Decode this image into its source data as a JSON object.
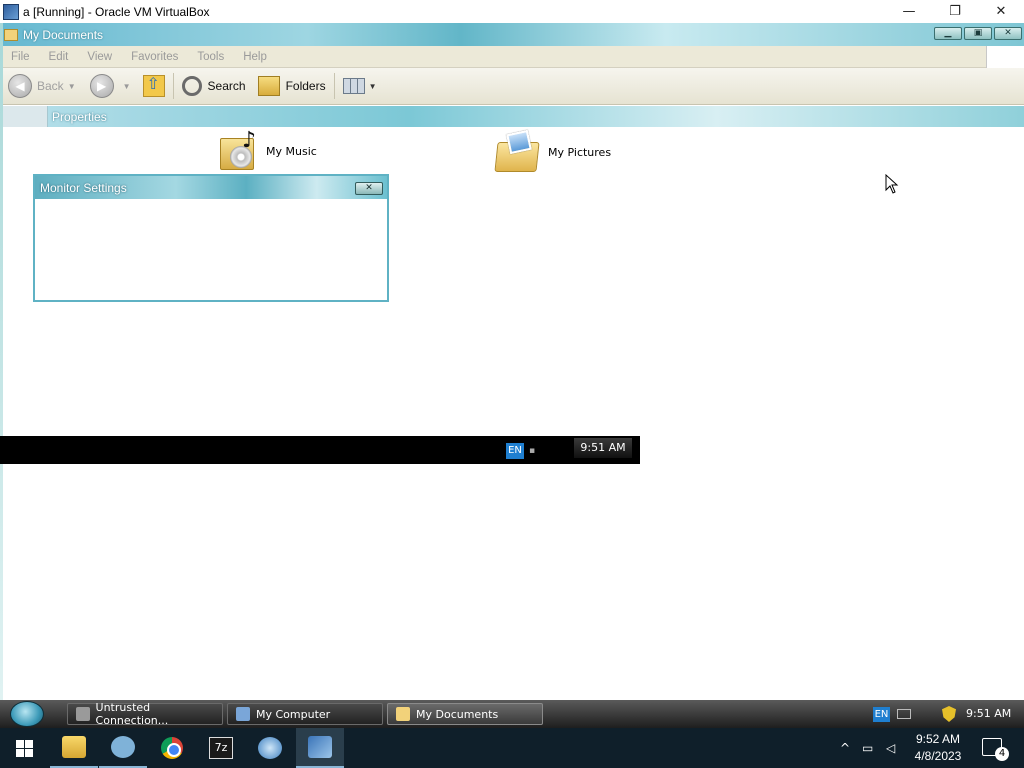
{
  "host_window": {
    "title": "a [Running] - Oracle VM VirtualBox",
    "controls": {
      "minimize": "—",
      "restore": "❐",
      "close": "✕"
    }
  },
  "explorer": {
    "title": "My Documents",
    "controls": {
      "minimize": "▁",
      "maximize": "▣",
      "close": "✕"
    },
    "menu": [
      "File",
      "Edit",
      "View",
      "Favorites",
      "Tools",
      "Help"
    ],
    "toolbar": {
      "back_label": "Back",
      "search_label": "Search",
      "folders_label": "Folders"
    },
    "address_text": "Properties",
    "items": [
      {
        "label": "My Music",
        "icon": "music-folder-icon"
      },
      {
        "label": "My Pictures",
        "icon": "pictures-folder-icon"
      }
    ]
  },
  "dialog": {
    "title": "Monitor Settings",
    "close": "✕"
  },
  "guest_strip": {
    "lang": "EN",
    "clock": "9:51 AM"
  },
  "guest_taskbar": {
    "tasks": [
      {
        "label": "Untrusted Connection...",
        "active": false
      },
      {
        "label": "My Computer",
        "active": false
      },
      {
        "label": "My Documents",
        "active": true
      }
    ],
    "lang": "EN",
    "clock": "9:51 AM"
  },
  "host_taskbar": {
    "apps": [
      "start",
      "file-explorer",
      "qt-creator",
      "chrome",
      "7-zip",
      "vmware-workstation",
      "virtualbox-xp"
    ],
    "seven_zip_label": "7z",
    "tray_chevron": "^",
    "clock_time": "9:52 AM",
    "clock_date": "4/8/2023",
    "notification_count": "4"
  },
  "colors": {
    "xp_title_accent": "#66b8d0",
    "host_taskbar_bg": "#0f1f2a",
    "lang_badge": "#1f7fd0"
  }
}
